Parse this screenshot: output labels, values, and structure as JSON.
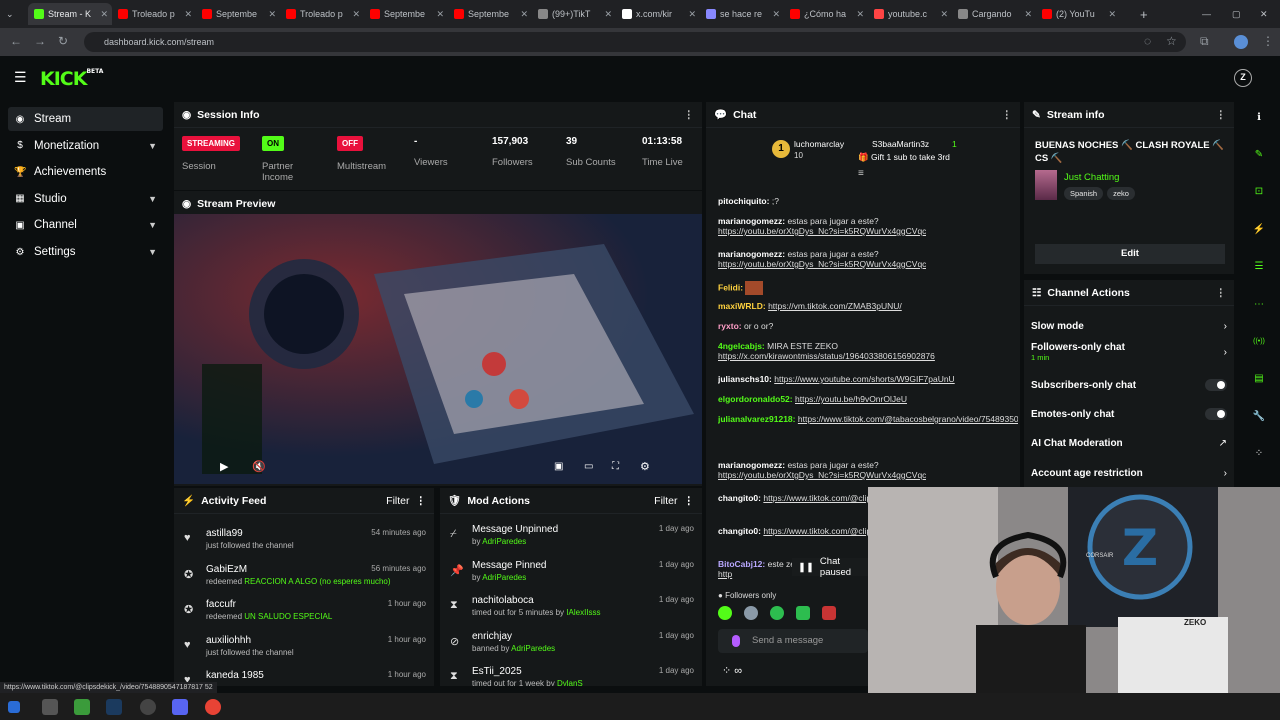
{
  "browser": {
    "tabs": [
      {
        "label": "Stream - K",
        "color": "#53fc18",
        "active": true
      },
      {
        "label": "Troleado p",
        "color": "#ff0000"
      },
      {
        "label": "Septembe",
        "color": "#ff0000"
      },
      {
        "label": "Troleado p",
        "color": "#ff0000"
      },
      {
        "label": "Septembe",
        "color": "#ff0000"
      },
      {
        "label": "Septembe",
        "color": "#ff0000"
      },
      {
        "label": "(99+)TikT",
        "color": "#888888"
      },
      {
        "label": "x.com/kir",
        "color": "#ffffff"
      },
      {
        "label": "se hace re",
        "color": "#8888ff"
      },
      {
        "label": "¿Cómo ha",
        "color": "#ff0000"
      },
      {
        "label": "youtube.c",
        "color": "#ff4444"
      },
      {
        "label": "Cargando",
        "color": "#888888"
      },
      {
        "label": "(2) YouTu",
        "color": "#ff0000"
      }
    ],
    "url": "dashboard.kick.com/stream",
    "status_url": "https://www.tiktok.com/@clipsdekick_/video/7548890547187817 52"
  },
  "header": {
    "logo": "KICK",
    "logo_sup": "BETA"
  },
  "sidebar": {
    "items": [
      {
        "label": "Stream",
        "icon": "radio-icon"
      },
      {
        "label": "Monetization",
        "icon": "dollar-icon"
      },
      {
        "label": "Achievements",
        "icon": "trophy-icon"
      },
      {
        "label": "Studio",
        "icon": "studio-icon"
      },
      {
        "label": "Channel",
        "icon": "channel-icon"
      },
      {
        "label": "Settings",
        "icon": "gear-icon"
      }
    ]
  },
  "session": {
    "title": "Session Info",
    "stats": [
      {
        "badge": "STREAMING",
        "label": "Session",
        "badge_color": "#e9113c"
      },
      {
        "badge": "ON",
        "label": "Partner Income",
        "badge_color": "#53fc18"
      },
      {
        "badge": "OFF",
        "label": "Multistream",
        "badge_color": "#e9113c"
      },
      {
        "value": "-",
        "label": "Viewers"
      },
      {
        "value": "157,903",
        "label": "Followers"
      },
      {
        "value": "39",
        "label": "Sub Counts"
      },
      {
        "value": "01:13:58",
        "label": "Time Live"
      }
    ]
  },
  "preview": {
    "title": "Stream Preview"
  },
  "activity": {
    "title": "Activity Feed",
    "filter": "Filter",
    "items": [
      {
        "name": "astilla99",
        "sub": "just followed the channel",
        "hl": "",
        "time": "54 minutes ago",
        "icon": "heart-icon"
      },
      {
        "name": "GabiEzM",
        "sub": "redeemed",
        "hl": "REACCION A ALGO (no esperes mucho)",
        "time": "56 minutes ago",
        "icon": "points-icon"
      },
      {
        "name": "faccufr",
        "sub": "redeemed",
        "hl": "UN SALUDO ESPECIAL",
        "time": "1 hour ago",
        "icon": "points-icon"
      },
      {
        "name": "auxiliohhh",
        "sub": "just followed the channel",
        "hl": "",
        "time": "1 hour ago",
        "icon": "heart-icon"
      },
      {
        "name": "kaneda 1985",
        "sub": "",
        "hl": "",
        "time": "1 hour ago",
        "icon": "heart-icon"
      }
    ]
  },
  "mod": {
    "title": "Mod Actions",
    "filter": "Filter",
    "items": [
      {
        "title": "Message Unpinned",
        "by": "by",
        "user": "AdriParedes",
        "time": "1 day ago",
        "icon": "unpin-icon"
      },
      {
        "title": "Message Pinned",
        "by": "by",
        "user": "AdriParedes",
        "time": "1 day ago",
        "icon": "pin-icon"
      },
      {
        "title": "nachitolaboca",
        "by": "timed out for 5 minutes by",
        "user": "IAlexIIsss",
        "time": "1 day ago",
        "icon": "timeout-icon"
      },
      {
        "title": "enrichjay",
        "by": "banned by",
        "user": "AdriParedes",
        "time": "1 day ago",
        "icon": "ban-icon"
      },
      {
        "title": "EsTii_2025",
        "by": "timed out for 1 week by",
        "user": "DylanS",
        "time": "1 day ago",
        "icon": "timeout-icon"
      }
    ]
  },
  "chat": {
    "title": "Chat",
    "pinned_user": "luchomarclay",
    "pinned_count": "10",
    "gift_user": "S3baaMartin3z",
    "gift_count": "1",
    "gift_text": "Gift 1 sub to take 3rd",
    "messages": [
      {
        "user": "pitochiquito:",
        "text": ";?",
        "link": "",
        "color": "#ffffff"
      },
      {
        "user": "marianogomezz:",
        "text": "estas para jugar a este?",
        "link": "https://youtu.be/orXtgDys_Nc?si=k5RQWurVx4ggCVqc",
        "color": "#ffffff"
      },
      {
        "user": "marianogomezz:",
        "text": "estas para jugar a este?",
        "link": "https://youtu.be/orXtgDys_Nc?si=k5RQWurVx4ggCVqc",
        "color": "#ffffff"
      },
      {
        "user": "Felidi:",
        "text": "",
        "link": "",
        "color": "#ffd23f"
      },
      {
        "user": "maxiWRLD:",
        "text": "",
        "link": "https://vm.tiktok.com/ZMAB3pUNU/",
        "color": "#ffd23f"
      },
      {
        "user": "ryxto:",
        "text": "or o or?",
        "link": "",
        "color": "#ff9ec7"
      },
      {
        "user": "4ngelcabjs:",
        "text": "MIRA ESTE ZEKO",
        "link": "https://x.com/kirawontmiss/status/1964033806156902876",
        "color": "#53fc18"
      },
      {
        "user": "julianschs10:",
        "text": "",
        "link": "https://www.youtube.com/shorts/W9GIF7paUnU",
        "color": "#ffffff"
      },
      {
        "user": "elgordoronaldo52:",
        "text": "",
        "link": "https://youtu.be/h9vOnrOlJeU",
        "color": "#53fc18"
      },
      {
        "user": "julianalvarez91218:",
        "text": "",
        "link": "https://www.tiktok.com/@tabacosbelgrano/video/7548935070971661574",
        "color": "#53fc18"
      },
      {
        "user": "marianogomezz:",
        "text": "estas para jugar a este?",
        "link": "https://youtu.be/orXtgDys_Nc?si=k5RQWurVx4ggCVqc",
        "color": "#ffffff"
      },
      {
        "user": "changito0:",
        "text": "",
        "link": "https://www.tiktok.com/@clipsdekick",
        "color": "#ffffff"
      },
      {
        "user": "changito0:",
        "text": "",
        "link": "https://www.tiktok.com/@clipsdekick",
        "color": "#ffffff"
      },
      {
        "user": "BitoCabj12:",
        "text": "este zeko",
        "link": "http",
        "color": "#b9a8ff"
      }
    ],
    "paused": "Chat paused",
    "followers_only": "Followers only",
    "placeholder": "Send a message"
  },
  "streaminfo": {
    "title": "Stream info",
    "stream_title": "BUENAS NOCHES ⛏️ CLASH ROYALE ⛏️ CS ⛏️",
    "category": "Just Chatting",
    "tags": [
      "Spanish",
      "zeko"
    ],
    "edit": "Edit"
  },
  "channel_actions": {
    "title": "Channel Actions",
    "items": [
      {
        "label": "Slow mode",
        "sub": "",
        "type": "chevron"
      },
      {
        "label": "Followers-only chat",
        "sub": "1 min",
        "type": "chevron"
      },
      {
        "label": "Subscribers-only chat",
        "sub": "",
        "type": "toggle"
      },
      {
        "label": "Emotes-only chat",
        "sub": "",
        "type": "toggle"
      },
      {
        "label": "AI Chat Moderation",
        "sub": "",
        "type": "link"
      },
      {
        "label": "Account age restriction",
        "sub": "",
        "type": "chevron"
      }
    ]
  },
  "webcam": {
    "shirt": "ZEKO",
    "brand": "CORSAIR"
  },
  "colors": {
    "accent": "#53fc18",
    "live": "#e9113c",
    "panel": "#151819",
    "bg": "#0b0e0f"
  }
}
